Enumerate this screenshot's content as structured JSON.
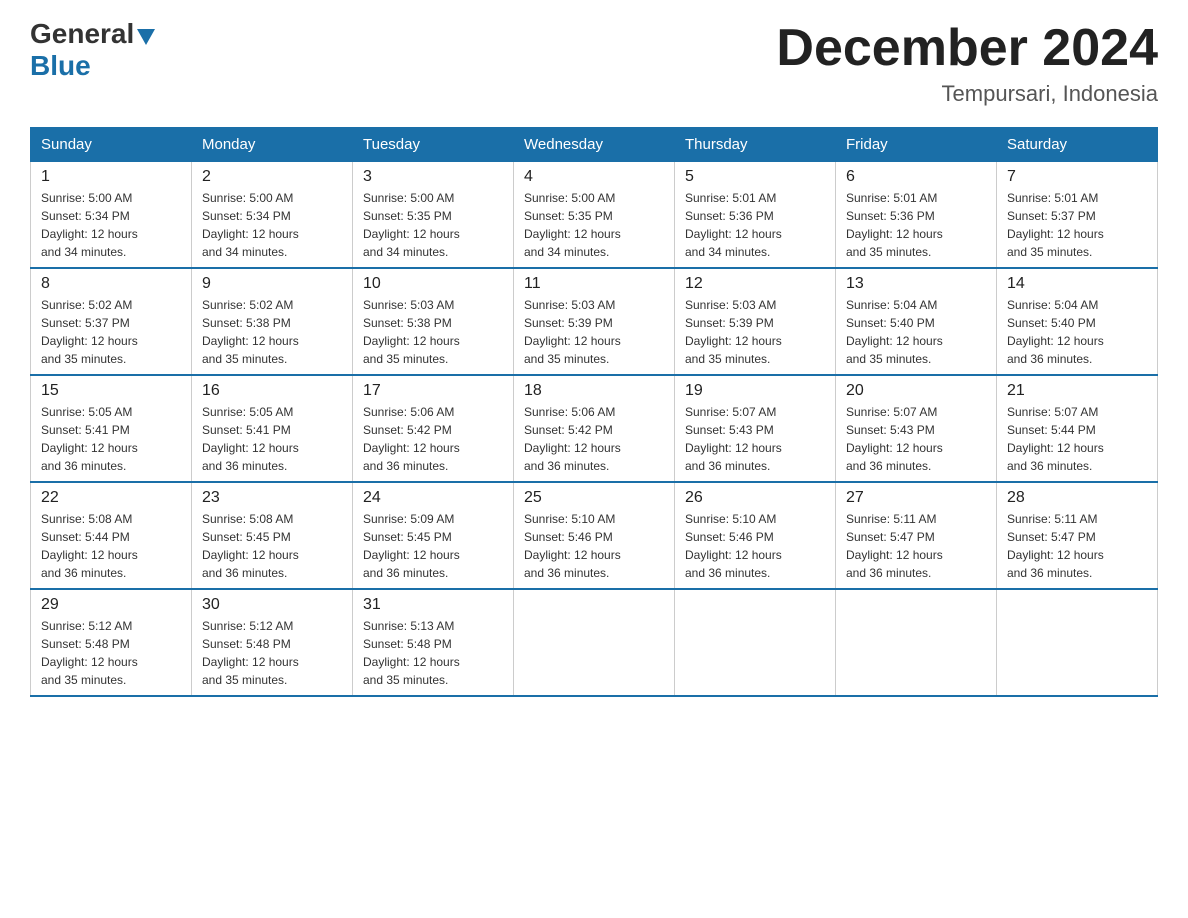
{
  "header": {
    "logo_general": "General",
    "logo_blue": "Blue",
    "title": "December 2024",
    "subtitle": "Tempursari, Indonesia"
  },
  "days_of_week": [
    "Sunday",
    "Monday",
    "Tuesday",
    "Wednesday",
    "Thursday",
    "Friday",
    "Saturday"
  ],
  "weeks": [
    [
      {
        "day": "1",
        "sunrise": "5:00 AM",
        "sunset": "5:34 PM",
        "daylight": "12 hours and 34 minutes."
      },
      {
        "day": "2",
        "sunrise": "5:00 AM",
        "sunset": "5:34 PM",
        "daylight": "12 hours and 34 minutes."
      },
      {
        "day": "3",
        "sunrise": "5:00 AM",
        "sunset": "5:35 PM",
        "daylight": "12 hours and 34 minutes."
      },
      {
        "day": "4",
        "sunrise": "5:00 AM",
        "sunset": "5:35 PM",
        "daylight": "12 hours and 34 minutes."
      },
      {
        "day": "5",
        "sunrise": "5:01 AM",
        "sunset": "5:36 PM",
        "daylight": "12 hours and 34 minutes."
      },
      {
        "day": "6",
        "sunrise": "5:01 AM",
        "sunset": "5:36 PM",
        "daylight": "12 hours and 35 minutes."
      },
      {
        "day": "7",
        "sunrise": "5:01 AM",
        "sunset": "5:37 PM",
        "daylight": "12 hours and 35 minutes."
      }
    ],
    [
      {
        "day": "8",
        "sunrise": "5:02 AM",
        "sunset": "5:37 PM",
        "daylight": "12 hours and 35 minutes."
      },
      {
        "day": "9",
        "sunrise": "5:02 AM",
        "sunset": "5:38 PM",
        "daylight": "12 hours and 35 minutes."
      },
      {
        "day": "10",
        "sunrise": "5:03 AM",
        "sunset": "5:38 PM",
        "daylight": "12 hours and 35 minutes."
      },
      {
        "day": "11",
        "sunrise": "5:03 AM",
        "sunset": "5:39 PM",
        "daylight": "12 hours and 35 minutes."
      },
      {
        "day": "12",
        "sunrise": "5:03 AM",
        "sunset": "5:39 PM",
        "daylight": "12 hours and 35 minutes."
      },
      {
        "day": "13",
        "sunrise": "5:04 AM",
        "sunset": "5:40 PM",
        "daylight": "12 hours and 35 minutes."
      },
      {
        "day": "14",
        "sunrise": "5:04 AM",
        "sunset": "5:40 PM",
        "daylight": "12 hours and 36 minutes."
      }
    ],
    [
      {
        "day": "15",
        "sunrise": "5:05 AM",
        "sunset": "5:41 PM",
        "daylight": "12 hours and 36 minutes."
      },
      {
        "day": "16",
        "sunrise": "5:05 AM",
        "sunset": "5:41 PM",
        "daylight": "12 hours and 36 minutes."
      },
      {
        "day": "17",
        "sunrise": "5:06 AM",
        "sunset": "5:42 PM",
        "daylight": "12 hours and 36 minutes."
      },
      {
        "day": "18",
        "sunrise": "5:06 AM",
        "sunset": "5:42 PM",
        "daylight": "12 hours and 36 minutes."
      },
      {
        "day": "19",
        "sunrise": "5:07 AM",
        "sunset": "5:43 PM",
        "daylight": "12 hours and 36 minutes."
      },
      {
        "day": "20",
        "sunrise": "5:07 AM",
        "sunset": "5:43 PM",
        "daylight": "12 hours and 36 minutes."
      },
      {
        "day": "21",
        "sunrise": "5:07 AM",
        "sunset": "5:44 PM",
        "daylight": "12 hours and 36 minutes."
      }
    ],
    [
      {
        "day": "22",
        "sunrise": "5:08 AM",
        "sunset": "5:44 PM",
        "daylight": "12 hours and 36 minutes."
      },
      {
        "day": "23",
        "sunrise": "5:08 AM",
        "sunset": "5:45 PM",
        "daylight": "12 hours and 36 minutes."
      },
      {
        "day": "24",
        "sunrise": "5:09 AM",
        "sunset": "5:45 PM",
        "daylight": "12 hours and 36 minutes."
      },
      {
        "day": "25",
        "sunrise": "5:10 AM",
        "sunset": "5:46 PM",
        "daylight": "12 hours and 36 minutes."
      },
      {
        "day": "26",
        "sunrise": "5:10 AM",
        "sunset": "5:46 PM",
        "daylight": "12 hours and 36 minutes."
      },
      {
        "day": "27",
        "sunrise": "5:11 AM",
        "sunset": "5:47 PM",
        "daylight": "12 hours and 36 minutes."
      },
      {
        "day": "28",
        "sunrise": "5:11 AM",
        "sunset": "5:47 PM",
        "daylight": "12 hours and 36 minutes."
      }
    ],
    [
      {
        "day": "29",
        "sunrise": "5:12 AM",
        "sunset": "5:48 PM",
        "daylight": "12 hours and 35 minutes."
      },
      {
        "day": "30",
        "sunrise": "5:12 AM",
        "sunset": "5:48 PM",
        "daylight": "12 hours and 35 minutes."
      },
      {
        "day": "31",
        "sunrise": "5:13 AM",
        "sunset": "5:48 PM",
        "daylight": "12 hours and 35 minutes."
      },
      null,
      null,
      null,
      null
    ]
  ],
  "labels": {
    "sunrise": "Sunrise:",
    "sunset": "Sunset:",
    "daylight": "Daylight:"
  }
}
